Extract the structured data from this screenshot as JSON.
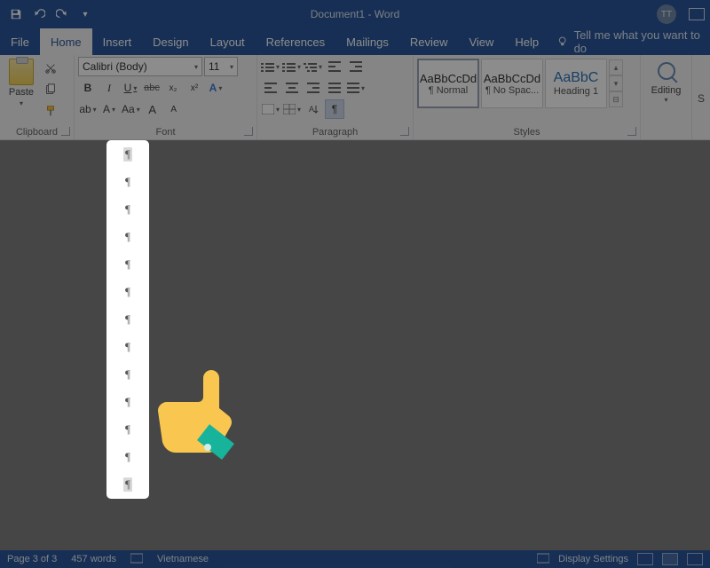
{
  "title": "Document1 - Word",
  "avatar": "TT",
  "tabs": {
    "file": "File",
    "home": "Home",
    "insert": "Insert",
    "design": "Design",
    "layout": "Layout",
    "references": "References",
    "mailings": "Mailings",
    "review": "Review",
    "view": "View",
    "help": "Help",
    "tellme": "Tell me what you want to do"
  },
  "ribbon": {
    "clipboard": {
      "label": "Clipboard",
      "paste": "Paste"
    },
    "font": {
      "label": "Font",
      "name": "Calibri (Body)",
      "size": "11",
      "bold": "B",
      "italic": "I",
      "underline": "U",
      "strike": "abc",
      "sub": "x",
      "sup": "x",
      "caseAa": "Aa",
      "growA": "A",
      "shrinkA": "A",
      "textEffA": "A",
      "hiliteAb": "ab",
      "colorA": "A"
    },
    "paragraph": {
      "label": "Paragraph",
      "pilcrow": "¶"
    },
    "styles": {
      "label": "Styles",
      "items": [
        {
          "preview": "AaBbCcDd",
          "name": "¶ Normal"
        },
        {
          "preview": "AaBbCcDd",
          "name": "¶ No Spac..."
        },
        {
          "preview": "AaBbC",
          "name": "Heading 1"
        }
      ]
    },
    "editing": {
      "label": "Editing"
    },
    "s": "S"
  },
  "status": {
    "page": "Page 3 of 3",
    "words": "457 words",
    "lang": "Vietnamese",
    "display": "Display Settings"
  }
}
